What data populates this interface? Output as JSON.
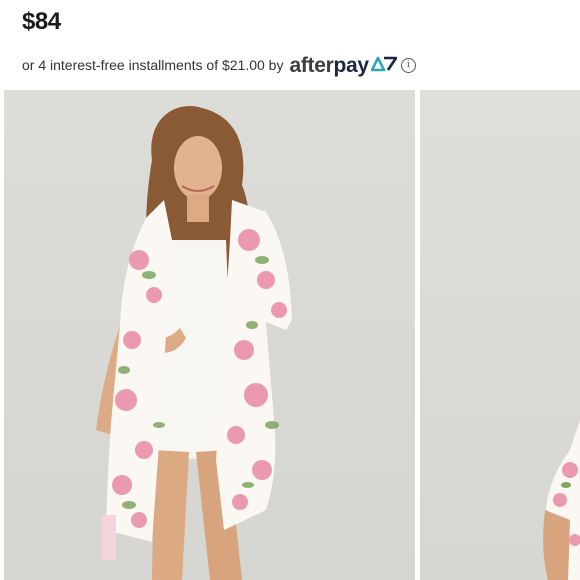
{
  "product": {
    "price": "$84",
    "installment_prefix": "or 4 interest-free installments of $21.00 by",
    "afterpay": {
      "after": "after",
      "pay": "pay",
      "info_glyph": "i"
    }
  },
  "gallery": {
    "images": [
      {
        "name": "model-floral-robe-front"
      },
      {
        "name": "model-floral-robe-partial"
      }
    ]
  },
  "colors": {
    "afterpay_mint": "#2aa7b8",
    "robe_pink": "#ea8fab",
    "leaf_green": "#7fa45d"
  }
}
